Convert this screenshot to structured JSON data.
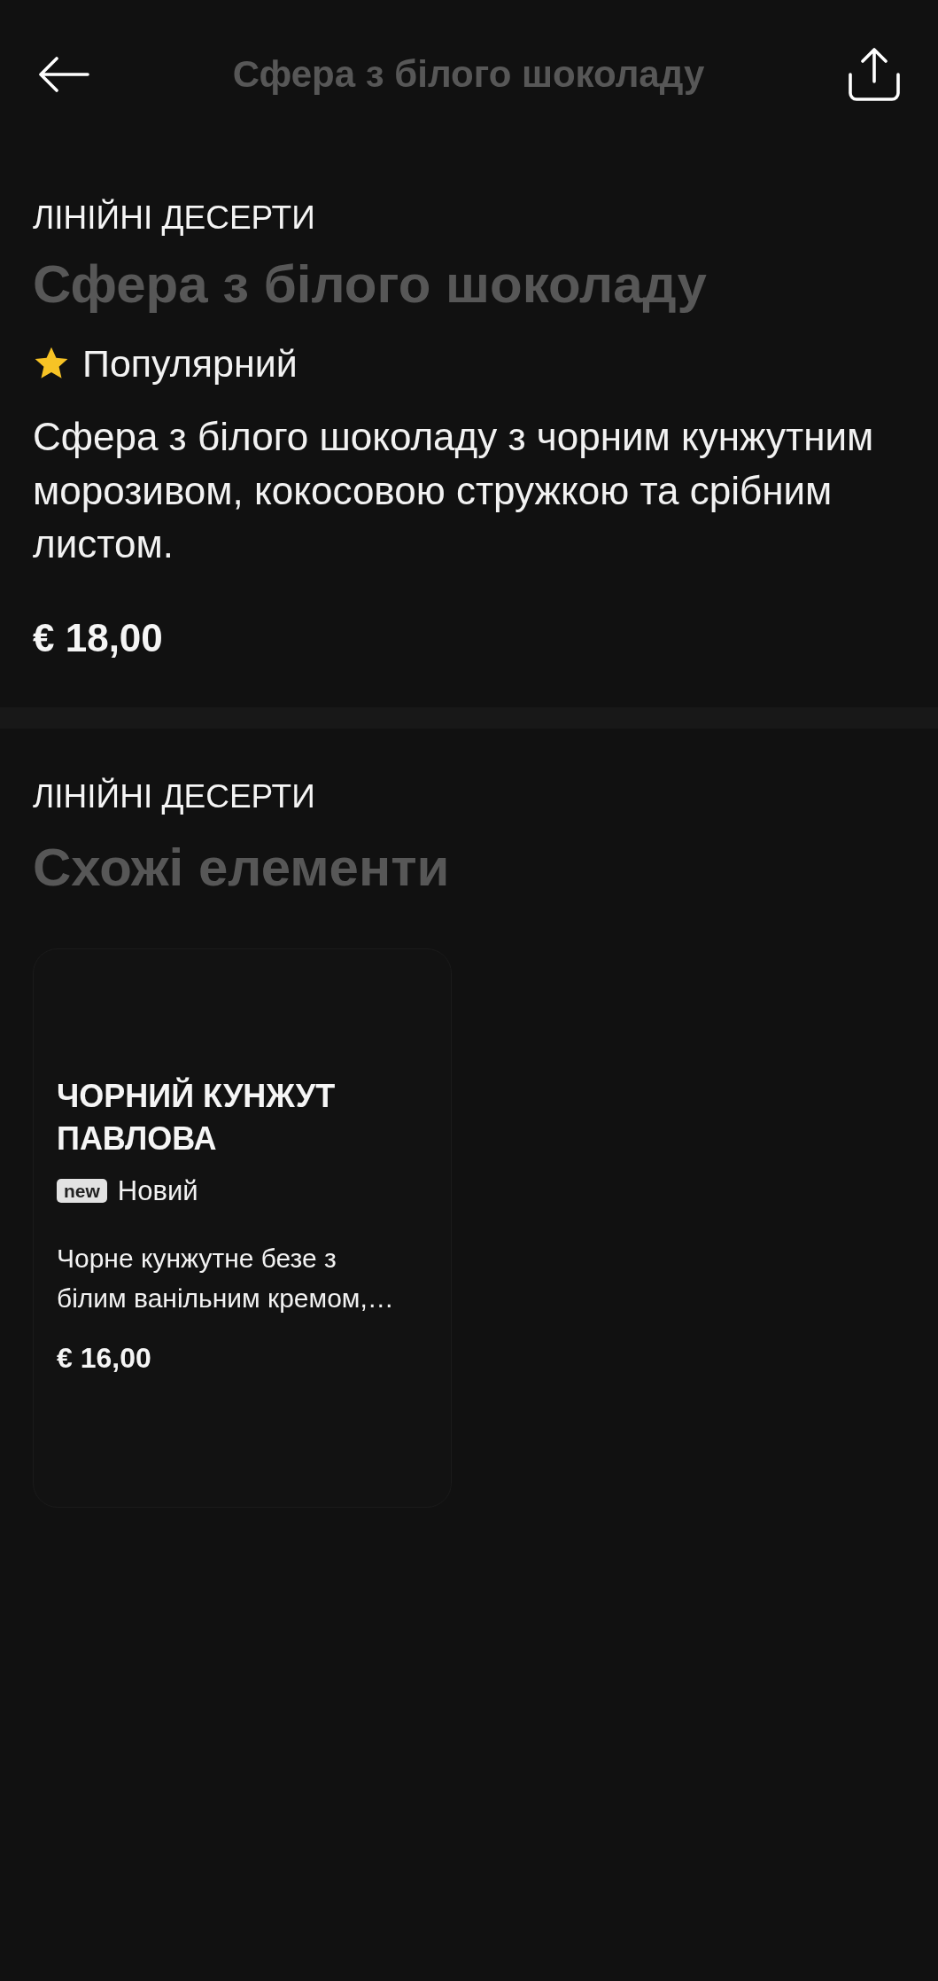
{
  "header": {
    "title": "Сфера з білого шоколаду"
  },
  "product": {
    "category": "ЛІНІЙНІ ДЕСЕРТИ",
    "name": "Сфера з білого шоколаду",
    "badge": {
      "kind": "popular",
      "label": "Популярний"
    },
    "description": "Сфера з білого шоколаду з чорним кунжутним морозивом, кокосовою стружкою та срібним листом.",
    "price": "€ 18,00"
  },
  "similar": {
    "category": "ЛІНІЙНІ ДЕСЕРТИ",
    "title": "Схожі елементи",
    "items": [
      {
        "name": "ЧОРНИЙ КУНЖУТ ПАВЛОВА",
        "badge": {
          "kind": "new",
          "tag": "new",
          "label": "Новий"
        },
        "description": "Чорне кунжутне безе з білим ванільним кремом,…",
        "price": "€ 16,00"
      }
    ]
  }
}
